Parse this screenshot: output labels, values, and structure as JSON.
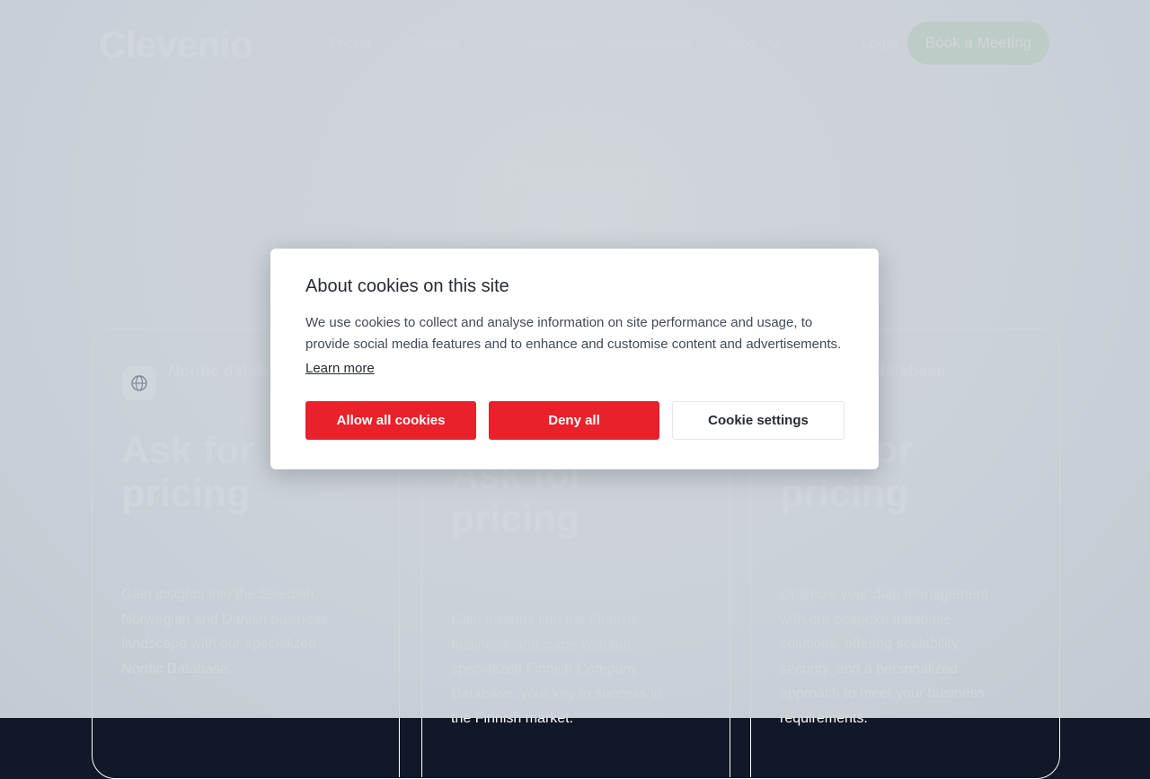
{
  "brand": {
    "logo": "Clevenio"
  },
  "nav": {
    "pricing": "Pricing",
    "features": "Features",
    "careers": "Careers",
    "case_studies": "Case Studies",
    "blog": "Blog",
    "login": "Login",
    "book_meeting": "Book a Meeting"
  },
  "page": {
    "title": "Pricing"
  },
  "cards": [
    {
      "icon": "globe-icon",
      "name": "Nordic database",
      "price": "Ask for pricing",
      "description": "Gain insights into the Swedish, Norwegian and Danish business landscape with our specialized Nordic Database."
    },
    {
      "price": "Ask for pricing",
      "description": "Gain insights into the Finnish business landscape with our specialized Finnish Company Database, your key to success in the Finnish market."
    },
    {
      "name": "Custom database",
      "price": "Ask for pricing",
      "description": "Optimize your data management with our bespoke database solutions, offering scalability, security, and a personalized approach to meet your business requirements."
    }
  ],
  "cookie_dialog": {
    "title": "About cookies on this site",
    "body": "We use cookies to collect and analyse information on site performance and usage, to provide social media features and to enhance and customise content and advertisements.",
    "learn_more": "Learn more",
    "allow_all": "Allow all cookies",
    "deny_all": "Deny all",
    "settings": "Cookie settings"
  },
  "colors": {
    "accent_red": "#e8212b",
    "meeting_button": "#e6f3e6",
    "overlay": "#1b304d"
  }
}
